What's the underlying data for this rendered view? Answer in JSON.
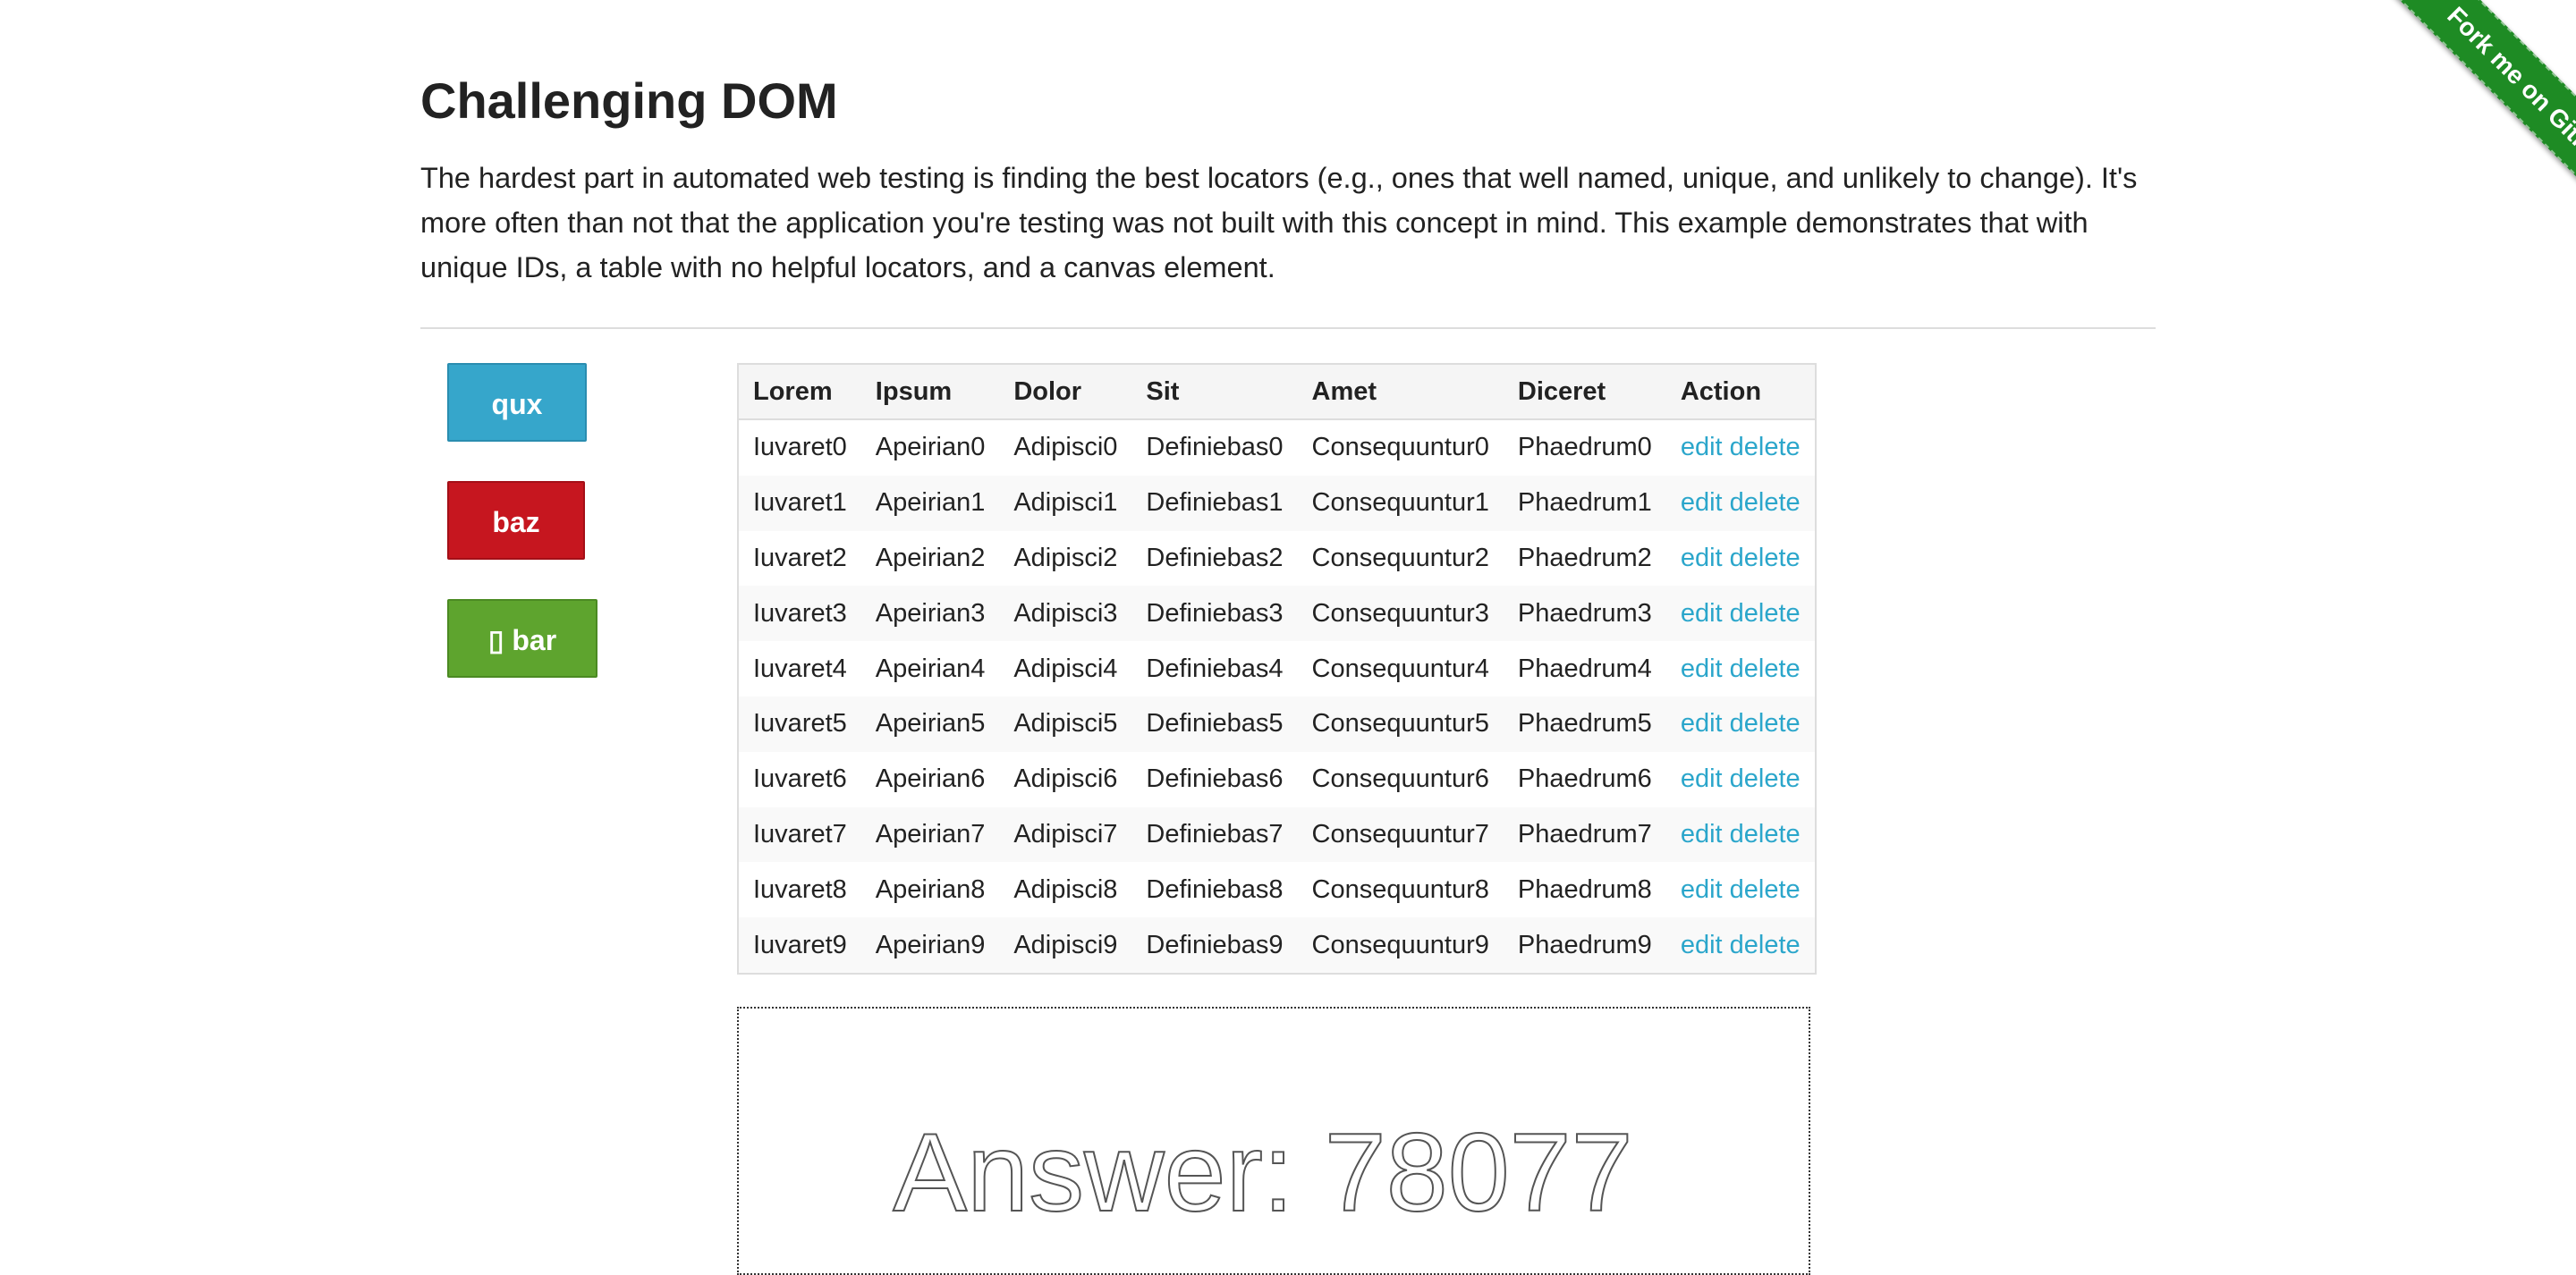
{
  "header": {
    "title": "Challenging DOM",
    "description": "The hardest part in automated web testing is finding the best locators (e.g., ones that well named, unique, and unlikely to change). It's more often than not that the application you're testing was not built with this concept in mind. This example demonstrates that with unique IDs, a table with no helpful locators, and a canvas element."
  },
  "buttons": {
    "qux": "qux",
    "baz": "baz",
    "bar": "▯ bar"
  },
  "table": {
    "headers": [
      "Lorem",
      "Ipsum",
      "Dolor",
      "Sit",
      "Amet",
      "Diceret",
      "Action"
    ],
    "rows": [
      [
        "Iuvaret0",
        "Apeirian0",
        "Adipisci0",
        "Definiebas0",
        "Consequuntur0",
        "Phaedrum0"
      ],
      [
        "Iuvaret1",
        "Apeirian1",
        "Adipisci1",
        "Definiebas1",
        "Consequuntur1",
        "Phaedrum1"
      ],
      [
        "Iuvaret2",
        "Apeirian2",
        "Adipisci2",
        "Definiebas2",
        "Consequuntur2",
        "Phaedrum2"
      ],
      [
        "Iuvaret3",
        "Apeirian3",
        "Adipisci3",
        "Definiebas3",
        "Consequuntur3",
        "Phaedrum3"
      ],
      [
        "Iuvaret4",
        "Apeirian4",
        "Adipisci4",
        "Definiebas4",
        "Consequuntur4",
        "Phaedrum4"
      ],
      [
        "Iuvaret5",
        "Apeirian5",
        "Adipisci5",
        "Definiebas5",
        "Consequuntur5",
        "Phaedrum5"
      ],
      [
        "Iuvaret6",
        "Apeirian6",
        "Adipisci6",
        "Definiebas6",
        "Consequuntur6",
        "Phaedrum6"
      ],
      [
        "Iuvaret7",
        "Apeirian7",
        "Adipisci7",
        "Definiebas7",
        "Consequuntur7",
        "Phaedrum7"
      ],
      [
        "Iuvaret8",
        "Apeirian8",
        "Adipisci8",
        "Definiebas8",
        "Consequuntur8",
        "Phaedrum8"
      ],
      [
        "Iuvaret9",
        "Apeirian9",
        "Adipisci9",
        "Definiebas9",
        "Consequuntur9",
        "Phaedrum9"
      ]
    ],
    "action_edit": "edit",
    "action_delete": "delete"
  },
  "canvas": {
    "text": "Answer: 78077"
  },
  "ribbon": {
    "label": "Fork me on GitHub"
  },
  "colors": {
    "qux": "#36a6cb",
    "baz": "#c6161f",
    "bar": "#5ea42e",
    "link": "#2ba6cb",
    "ribbon": "#1e8b24"
  }
}
